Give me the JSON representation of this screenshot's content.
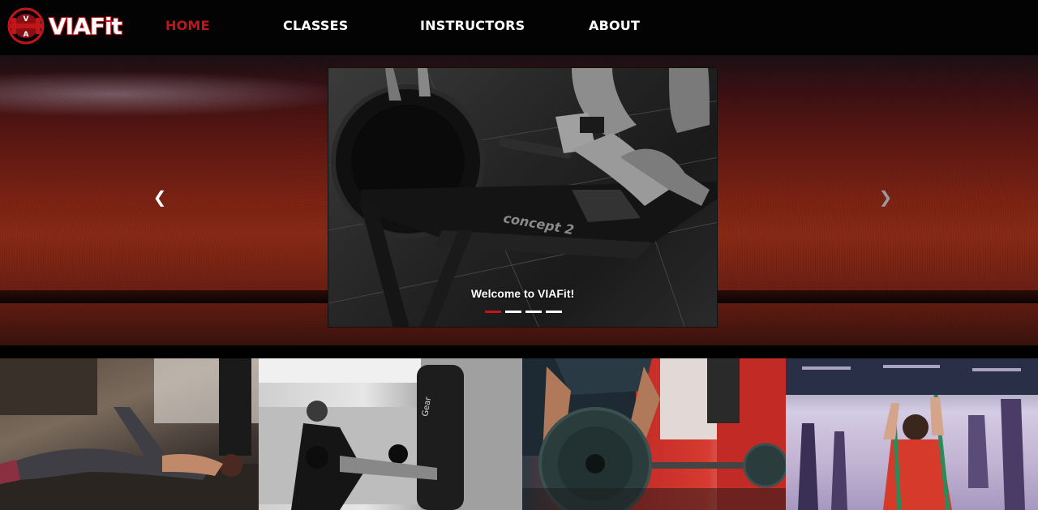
{
  "brand": {
    "name": "VIAFit",
    "accent": "#c0161b"
  },
  "nav": {
    "items": [
      {
        "label": "HOME",
        "active": true
      },
      {
        "label": "CLASSES",
        "active": false
      },
      {
        "label": "INSTRUCTORS",
        "active": false
      },
      {
        "label": "ABOUT",
        "active": false
      }
    ]
  },
  "carousel": {
    "prev_icon": "chevron-left-icon",
    "next_icon": "chevron-right-icon",
    "prev_glyph": "❮",
    "next_glyph": "❯",
    "caption": "Welcome to VIAFit!",
    "slide_count": 4,
    "active_index": 0
  },
  "gallery": {
    "photos": [
      "stretching-class",
      "kickboxing",
      "weight-plate-loading",
      "resistance-band-class"
    ]
  }
}
